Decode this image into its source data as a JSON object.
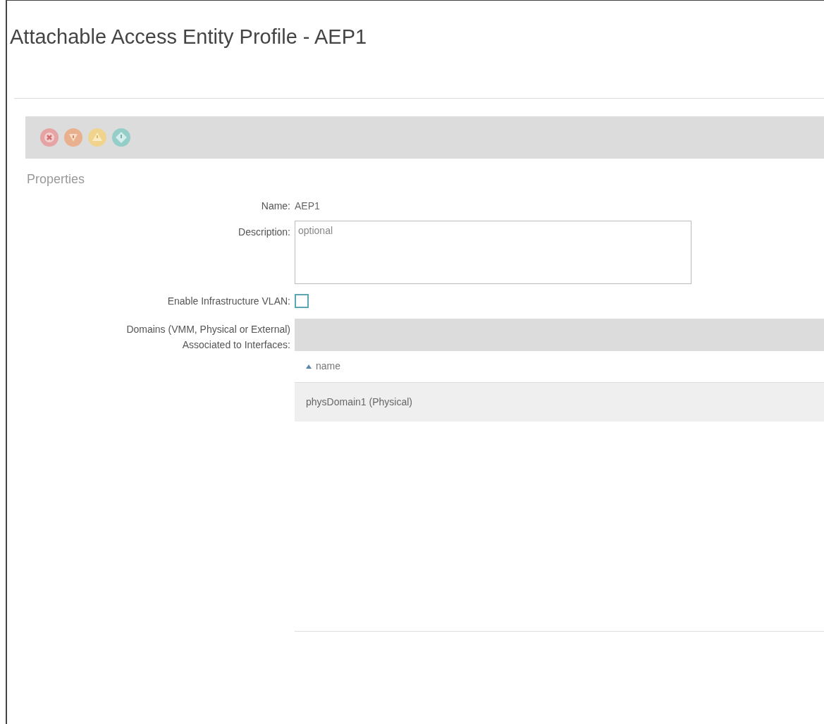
{
  "title": "Attachable Access Entity Profile - AEP1",
  "properties": {
    "heading": "Properties",
    "name": {
      "label": "Name:",
      "value": "AEP1"
    },
    "description": {
      "label": "Description:",
      "placeholder": "optional"
    },
    "infra_vlan": {
      "label": "Enable Infrastructure VLAN:",
      "checked": false
    },
    "domains": {
      "label": "Domains (VMM, Physical or External) Associated to Interfaces:",
      "columns": [
        {
          "label": "name",
          "sorted_ascending": true
        }
      ],
      "rows": [
        {
          "name": "physDomain1 (Physical)",
          "selected": false
        }
      ]
    }
  }
}
